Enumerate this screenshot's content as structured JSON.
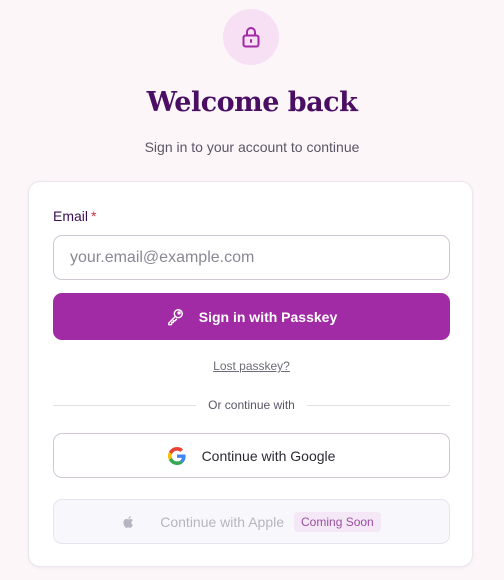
{
  "header": {
    "icon": "lock-icon",
    "title": "Welcome back",
    "subtitle": "Sign in to your account to continue"
  },
  "form": {
    "email_label": "Email",
    "required_mark": "*",
    "email_placeholder": "your.email@example.com",
    "email_value": "",
    "passkey_button": "Sign in with Passkey",
    "passkey_icon": "key-icon",
    "lost_passkey_link": "Lost passkey?",
    "divider_text": "Or continue with",
    "google_button": "Continue with Google",
    "google_icon": "google-icon",
    "apple_button": "Continue with Apple",
    "apple_icon": "apple-icon",
    "apple_badge": "Coming Soon"
  },
  "colors": {
    "accent": "#a12ba4",
    "title": "#4a0f63",
    "icon_badge_bg": "#f7dff4",
    "page_bg": "#fcf6f9",
    "required": "#d0314b"
  }
}
